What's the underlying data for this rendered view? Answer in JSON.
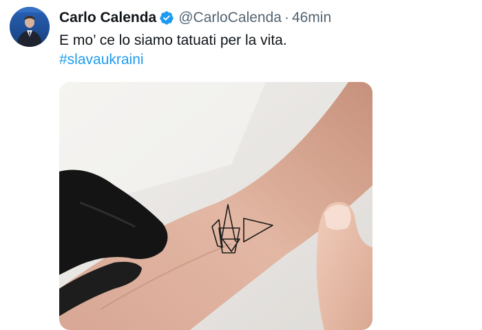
{
  "tweet": {
    "author_name": "Carlo Calenda",
    "handle": "@CarloCalenda",
    "separator": "·",
    "time": "46min",
    "text": "E mo’ ce lo siamo tatuati per la vita.",
    "hashtag": "#slavaukraini",
    "verified_icon": "verified-badge-icon",
    "accent_color": "#1d9bf0",
    "media_description_icon": "tattoo-photo"
  }
}
